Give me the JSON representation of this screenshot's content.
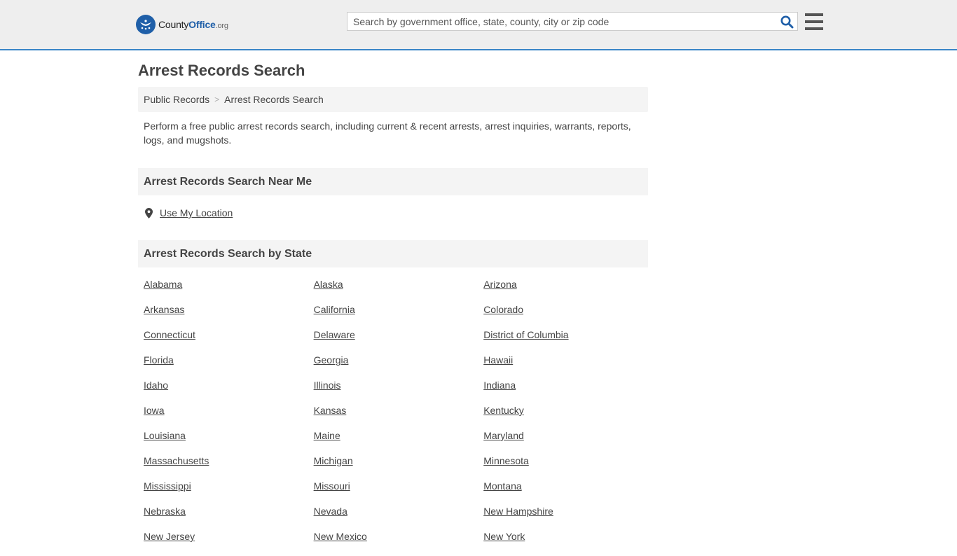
{
  "header": {
    "logo": {
      "county": "County",
      "office": "Office",
      "tld": ".org"
    },
    "search": {
      "placeholder": "Search by government office, state, county, city or zip code"
    },
    "icons": {
      "search": "search-icon",
      "menu": "hamburger-menu-icon",
      "logo": "eagle-stars-icon"
    }
  },
  "page": {
    "title": "Arrest Records Search",
    "breadcrumb": [
      "Public Records",
      "Arrest Records Search"
    ],
    "intro": "Perform a free public arrest records search, including current & recent arrests, arrest inquiries, warrants, reports, logs, and mugshots."
  },
  "near_me": {
    "heading": "Arrest Records Search Near Me",
    "link": "Use My Location",
    "icon": "map-marker-icon"
  },
  "by_state": {
    "heading": "Arrest Records Search by State",
    "states": [
      "Alabama",
      "Alaska",
      "Arizona",
      "Arkansas",
      "California",
      "Colorado",
      "Connecticut",
      "Delaware",
      "District of Columbia",
      "Florida",
      "Georgia",
      "Hawaii",
      "Idaho",
      "Illinois",
      "Indiana",
      "Iowa",
      "Kansas",
      "Kentucky",
      "Louisiana",
      "Maine",
      "Maryland",
      "Massachusetts",
      "Michigan",
      "Minnesota",
      "Mississippi",
      "Missouri",
      "Montana",
      "Nebraska",
      "Nevada",
      "New Hampshire",
      "New Jersey",
      "New Mexico",
      "New York"
    ]
  },
  "colors": {
    "accent": "#1f5fa8",
    "header_bg": "#eeeeee",
    "header_border": "#3a85c7",
    "panel_bg": "#f4f4f4",
    "text": "#444444"
  }
}
